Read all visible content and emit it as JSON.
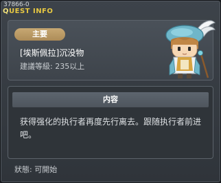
{
  "window": {
    "id": "37866-0",
    "title_lead": "Q",
    "title_rest": "UEST INFO"
  },
  "quest": {
    "category": "主要",
    "name": "[埃斯佩拉]沉没物",
    "level_requirement": "建議等級: 235以上",
    "npc_icon": "npc-portrait-icon"
  },
  "content": {
    "header": "内容",
    "body": "获得强化的执行者再度先行离去。跟随执行者前进吧。"
  },
  "status": {
    "text": "狀態: 可開始"
  },
  "colors": {
    "title": "#e7c842",
    "badge": "#b89660",
    "panel": "#3e444b"
  }
}
